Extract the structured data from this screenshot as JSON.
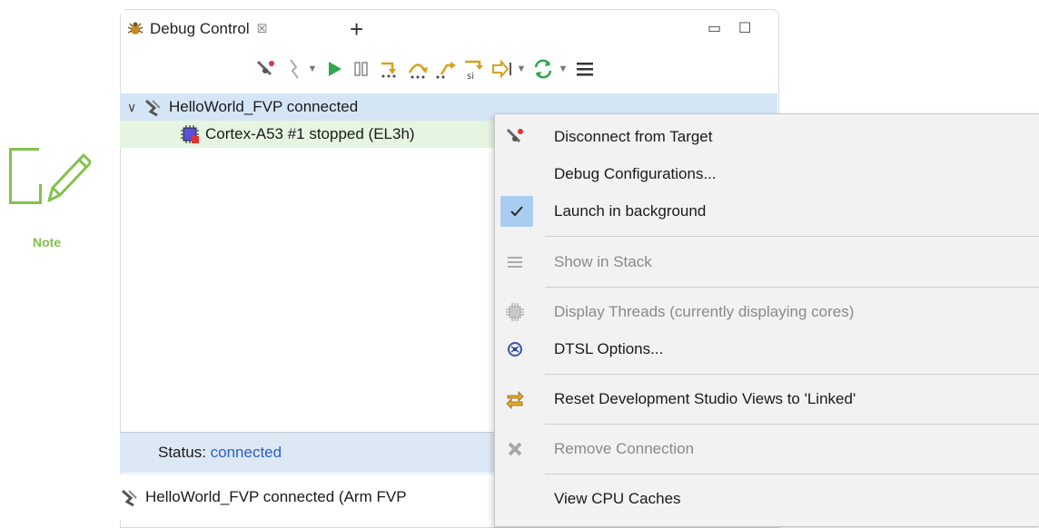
{
  "note": {
    "label": "Note"
  },
  "view": {
    "tab_title": "Debug Control",
    "tab_close_glyph": "☒",
    "add_tab_glyph": "+",
    "minimize_glyph": "▭",
    "maximize_glyph": "☐"
  },
  "toolbar": {
    "icons": [
      "disconnect-icon",
      "connect-icon",
      "dropdown-icon",
      "resume-icon",
      "suspend-icon",
      "step-into-icon",
      "step-over-icon",
      "step-out-icon",
      "step-instruction-icon",
      "run-to-line-icon",
      "dropdown-icon",
      "sync-icon",
      "dropdown-icon",
      "view-menu-icon"
    ]
  },
  "tree": {
    "connection_label": "HelloWorld_FVP connected",
    "core_label": "Cortex-A53 #1 stopped (EL3h)"
  },
  "status": {
    "label": "Status: ",
    "value": "connected"
  },
  "info": {
    "label": "HelloWorld_FVP connected (Arm FVP"
  },
  "menu": {
    "items": [
      {
        "label": "Disconnect from Target",
        "icon": "disconnect-icon",
        "enabled": true
      },
      {
        "label": "Debug Configurations...",
        "icon": "",
        "enabled": true
      },
      {
        "label": "Launch in background",
        "icon": "check-icon",
        "enabled": true,
        "checked": true
      },
      {
        "label": "Show in Stack",
        "icon": "list-icon",
        "enabled": false
      },
      {
        "label": "Display Threads (currently displaying cores)",
        "icon": "chip-icon",
        "enabled": false
      },
      {
        "label": "DTSL Options...",
        "icon": "dtsl-icon",
        "enabled": true
      },
      {
        "label": "Reset Development Studio Views to 'Linked'",
        "icon": "link-views-icon",
        "enabled": true
      },
      {
        "label": "Remove Connection",
        "icon": "remove-icon",
        "enabled": false
      },
      {
        "label": "View CPU Caches",
        "icon": "",
        "enabled": true
      }
    ]
  },
  "colors": {
    "accent_note": "#84c14d",
    "selection": "#d4e6f6",
    "core_row": "#e6f5e1",
    "status_value": "#2a5fc7"
  }
}
